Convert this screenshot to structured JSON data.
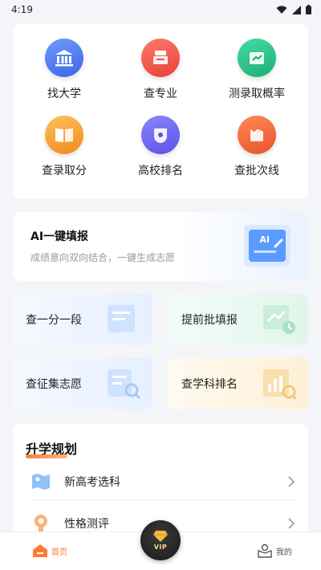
{
  "status_bar": {
    "time": "4:19"
  },
  "grid": [
    {
      "label": "找大学",
      "icon": "university-icon",
      "color": "#4f7cf0"
    },
    {
      "label": "查专业",
      "icon": "major-icon",
      "color": "#f2554b"
    },
    {
      "label": "测录取概率",
      "icon": "probability-icon",
      "color": "#27c08a"
    },
    {
      "label": "查录取分",
      "icon": "book-icon",
      "color": "#f7a23a"
    },
    {
      "label": "高校排名",
      "icon": "ranking-icon",
      "color": "#6c64f0"
    },
    {
      "label": "查批次线",
      "icon": "batch-line-icon",
      "color": "#f56a3a"
    }
  ],
  "ai_card": {
    "title": "AI一键填报",
    "subtitle": "成绩意向双向结合，一键生成志愿",
    "badge": "AI"
  },
  "tiles": [
    {
      "label": "查一分一段",
      "bg": "#eef6ff"
    },
    {
      "label": "提前批填报",
      "bg": "#eafaf2"
    },
    {
      "label": "查征集志愿",
      "bg": "#eef6ff"
    },
    {
      "label": "查学科排名",
      "bg": "#fff6e6"
    }
  ],
  "planning": {
    "title": "升学规划",
    "items": [
      {
        "label": "新高考选科",
        "icon": "subject-map-icon"
      },
      {
        "label": "性格测评",
        "icon": "personality-icon"
      }
    ]
  },
  "bottom_nav": {
    "home": "首页",
    "vip": "VIP",
    "mine": "我的"
  }
}
